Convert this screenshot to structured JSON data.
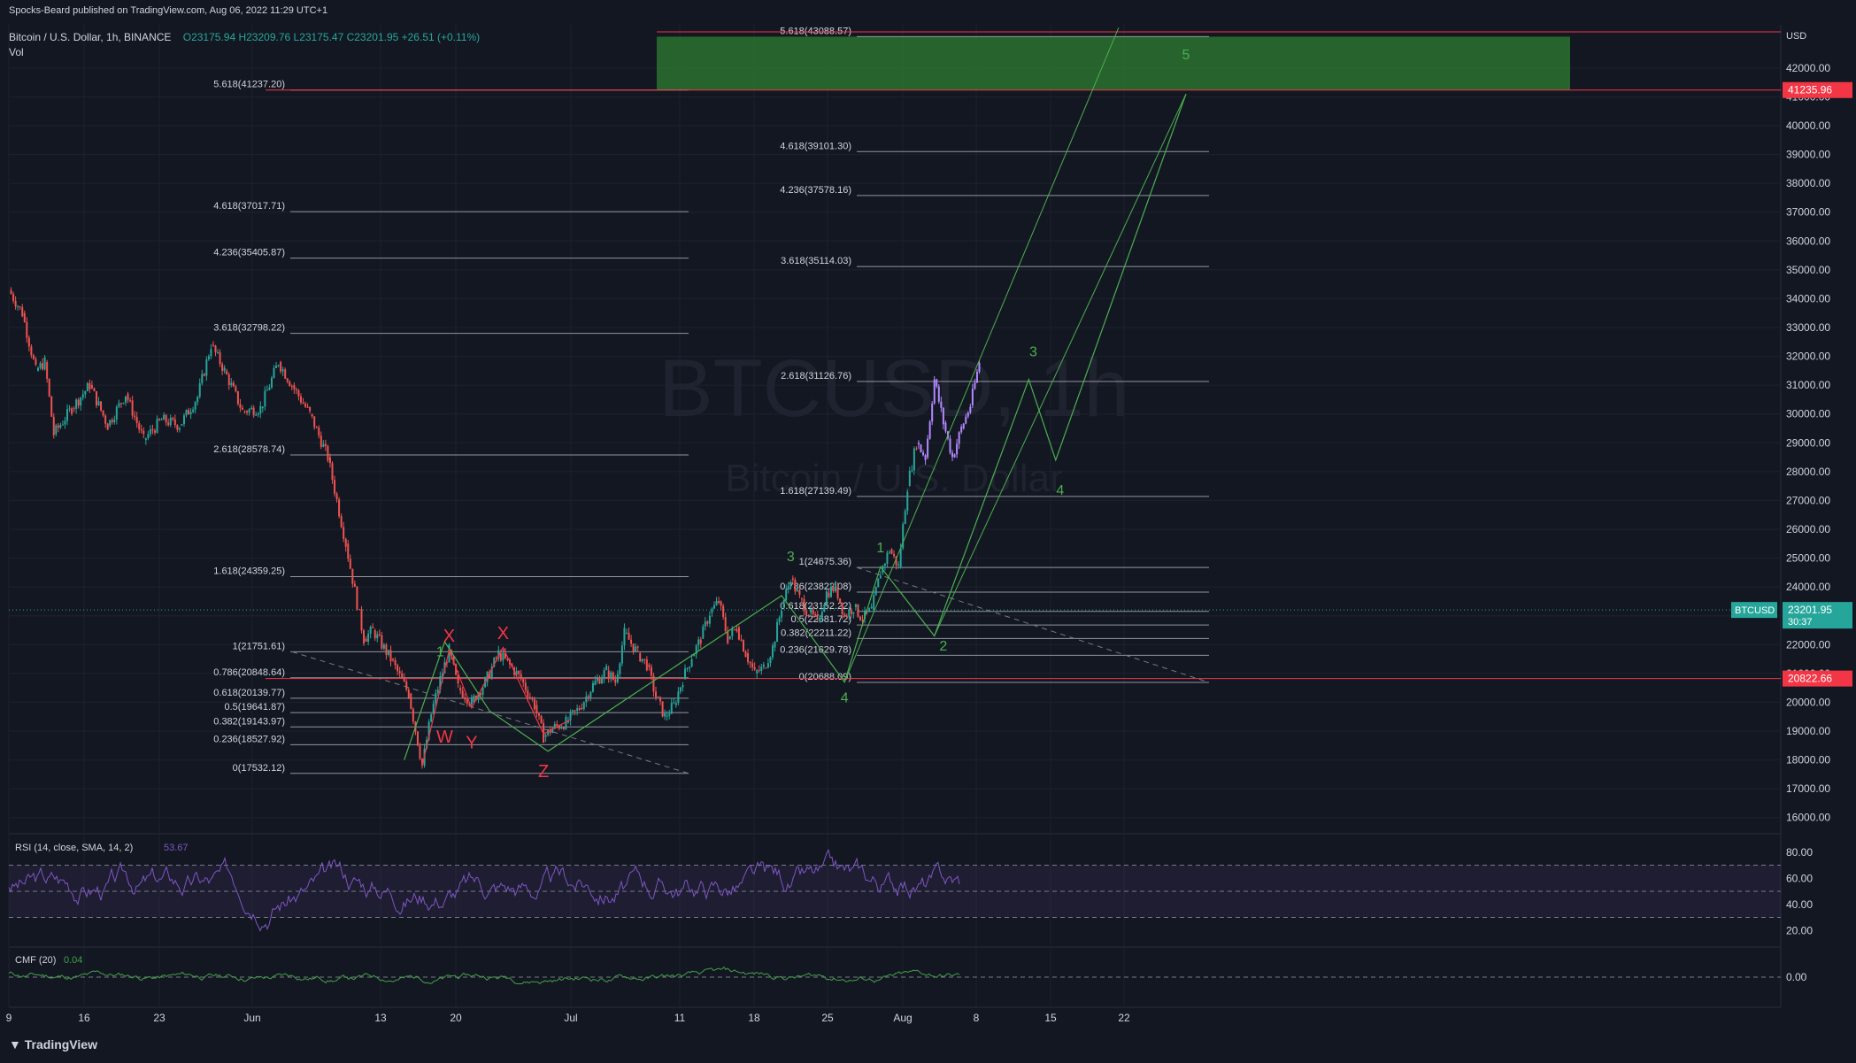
{
  "header": {
    "published": "Spocks-Beard published on TradingView.com, Aug 06, 2022 11:29 UTC+1",
    "symbol_line": "Bitcoin / U.S. Dollar, 1h, BINANCE",
    "ohlc": "O23175.94  H23209.76  L23175.47  C23201.95  +26.51 (+0.11%)",
    "vol_label": "Vol"
  },
  "watermark": {
    "symbol": "BTCUSD, 1h",
    "name": "Bitcoin / U.S. Dollar"
  },
  "footer": {
    "brand": "TradingView"
  },
  "colors": {
    "background": "#131722",
    "grid": "#1e222d",
    "up": "#26a69a",
    "down": "#ef5350",
    "wave": "#4caf50",
    "corrective": "#f23645",
    "rsi": "#7e57c2",
    "cmf": "#43a047",
    "fib": "#b2b5be",
    "price_tag": "#26a69a"
  },
  "chart_data": [
    {
      "type": "candlestick",
      "title": "Bitcoin / U.S. Dollar, 1h, BINANCE",
      "ylim": [
        15500,
        43500
      ],
      "price_axis": {
        "currency": "USD",
        "ticks": [
          16000,
          17000,
          18000,
          19000,
          20000,
          21000,
          22000,
          23000,
          24000,
          25000,
          26000,
          27000,
          28000,
          29000,
          30000,
          31000,
          32000,
          33000,
          34000,
          35000,
          36000,
          37000,
          38000,
          39000,
          40000,
          41000,
          42000
        ],
        "tick_labels": [
          "16000.00",
          "17000.00",
          "18000.00",
          "19000.00",
          "20000.00",
          "21000.00",
          "22000.00",
          "23000.00",
          "24000.00",
          "25000.00",
          "26000.00",
          "27000.00",
          "28000.00",
          "29000.00",
          "30000.00",
          "31000.00",
          "32000.00",
          "33000.00",
          "34000.00",
          "35000.00",
          "36000.00",
          "37000.00",
          "38000.00",
          "39000.00",
          "40000.00",
          "41000.00",
          "42000.00"
        ],
        "tags": [
          {
            "value": 41235.96,
            "label": "41235.96",
            "color": "#f23645"
          },
          {
            "value": 23201.95,
            "label": "23201.95",
            "sub": "30:37",
            "name": "BTCUSD",
            "color": "#26a69a"
          },
          {
            "value": 20822.66,
            "label": "20822.66",
            "color": "#f23645"
          }
        ]
      },
      "time_axis": {
        "labels": [
          "9",
          "16",
          "23",
          "Jun",
          "13",
          "20",
          "Jul",
          "11",
          "18",
          "25",
          "Aug",
          "8",
          "15",
          "22"
        ]
      },
      "price_path": [
        [
          0,
          34300
        ],
        [
          3,
          33500
        ],
        [
          6,
          31500
        ],
        [
          8,
          31800
        ],
        [
          10,
          29300
        ],
        [
          14,
          30200
        ],
        [
          18,
          31000
        ],
        [
          22,
          29600
        ],
        [
          26,
          30700
        ],
        [
          30,
          29100
        ],
        [
          34,
          29800
        ],
        [
          38,
          29600
        ],
        [
          42,
          30600
        ],
        [
          45,
          32400
        ],
        [
          48,
          31500
        ],
        [
          52,
          30100
        ],
        [
          56,
          30200
        ],
        [
          60,
          31800
        ],
        [
          63,
          31000
        ],
        [
          67,
          30000
        ],
        [
          71,
          28500
        ],
        [
          75,
          25500
        ],
        [
          79,
          22200
        ],
        [
          81,
          22500
        ],
        [
          85,
          21500
        ],
        [
          89,
          20300
        ],
        [
          92,
          17800
        ],
        [
          94,
          19600
        ],
        [
          96,
          20800
        ],
        [
          98,
          21800
        ],
        [
          100,
          20500
        ],
        [
          103,
          20000
        ],
        [
          106,
          20700
        ],
        [
          109,
          21700
        ],
        [
          112,
          21200
        ],
        [
          114,
          20800
        ],
        [
          117,
          19900
        ],
        [
          119,
          18800
        ],
        [
          121,
          19100
        ],
        [
          124,
          19300
        ],
        [
          127,
          19800
        ],
        [
          130,
          20600
        ],
        [
          133,
          21100
        ],
        [
          135,
          20700
        ],
        [
          137,
          22400
        ],
        [
          140,
          21700
        ],
        [
          142,
          21300
        ],
        [
          144,
          20200
        ],
        [
          146,
          19500
        ],
        [
          148,
          19900
        ],
        [
          150,
          20800
        ],
        [
          152,
          21600
        ],
        [
          154,
          22200
        ],
        [
          156,
          23100
        ],
        [
          158,
          23500
        ],
        [
          160,
          22200
        ],
        [
          162,
          22600
        ],
        [
          164,
          21700
        ],
        [
          166,
          21000
        ],
        [
          168,
          21200
        ],
        [
          170,
          21900
        ],
        [
          172,
          23300
        ],
        [
          174,
          24300
        ],
        [
          176,
          23600
        ],
        [
          178,
          23100
        ],
        [
          180,
          22800
        ],
        [
          182,
          23800
        ],
        [
          184,
          24000
        ],
        [
          186,
          23000
        ],
        [
          188,
          23300
        ],
        [
          190,
          22900
        ],
        [
          192,
          23200
        ],
        [
          194,
          24500
        ],
        [
          196,
          25300
        ],
        [
          198,
          24700
        ],
        [
          200,
          27500
        ],
        [
          202,
          29000
        ],
        [
          204,
          28500
        ],
        [
          206,
          31200
        ],
        [
          208,
          29700
        ],
        [
          210,
          28500
        ],
        [
          212,
          29500
        ],
        [
          214,
          30300
        ],
        [
          216,
          31800
        ]
      ],
      "projection_start_index": 202,
      "fib_levels_left": [
        {
          "label": "0(17532.12)",
          "value": 17532.12
        },
        {
          "label": "0.236(18527.92)",
          "value": 18527.92
        },
        {
          "label": "0.382(19143.97)",
          "value": 19143.97
        },
        {
          "label": "0.5(19641.87)",
          "value": 19641.87
        },
        {
          "label": "0.618(20139.77)",
          "value": 20139.77
        },
        {
          "label": "0.786(20848.64)",
          "value": 20848.64
        },
        {
          "label": "1(21751.61)",
          "value": 21751.61
        },
        {
          "label": "1.618(24359.25)",
          "value": 24359.25
        },
        {
          "label": "2.618(28578.74)",
          "value": 28578.74
        },
        {
          "label": "3.618(32798.22)",
          "value": 32798.22
        },
        {
          "label": "4.236(35405.87)",
          "value": 35405.87
        },
        {
          "label": "4.618(37017.71)",
          "value": 37017.71
        },
        {
          "label": "5.618(41237.20)",
          "value": 41237.2
        }
      ],
      "fib_levels_right": [
        {
          "label": "0(20688.09)",
          "value": 20688.09
        },
        {
          "label": "0.236(21629.78)",
          "value": 21629.78
        },
        {
          "label": "0.382(22211.22)",
          "value": 22211.22
        },
        {
          "label": "0.5(22681.72)",
          "value": 22681.72
        },
        {
          "label": "0.618(23152.22)",
          "value": 23152.22
        },
        {
          "label": "0.786(23822.08)",
          "value": 23822.08
        },
        {
          "label": "1(24675.36)",
          "value": 24675.36
        },
        {
          "label": "1.618(27139.49)",
          "value": 27139.49
        },
        {
          "label": "2.618(31126.76)",
          "value": 31126.76
        },
        {
          "label": "3.618(35114.03)",
          "value": 35114.03
        },
        {
          "label": "4.236(37578.16)",
          "value": 37578.16
        },
        {
          "label": "4.618(39101.30)",
          "value": 39101.3
        },
        {
          "label": "5.618(43088.57)",
          "value": 43088.57
        }
      ],
      "target_zone": {
        "from": 41235.96,
        "to": 43088.57
      },
      "wave_labels": [
        {
          "text": "X",
          "t": 98,
          "price": 22100,
          "color": "corrective"
        },
        {
          "text": "X",
          "t": 110,
          "price": 22200,
          "color": "corrective"
        },
        {
          "text": "W",
          "t": 97,
          "price": 18600,
          "color": "corrective"
        },
        {
          "text": "Y",
          "t": 103,
          "price": 18400,
          "color": "corrective"
        },
        {
          "text": "Z",
          "t": 119,
          "price": 17400,
          "color": "corrective"
        },
        {
          "text": "1",
          "t": 96,
          "price": 21600,
          "color": "wave"
        },
        {
          "text": "3",
          "t": 174,
          "price": 24900,
          "color": "wave"
        },
        {
          "text": "4",
          "t": 186,
          "price": 20000,
          "color": "wave"
        },
        {
          "text": "1",
          "t": 194,
          "price": 25200,
          "color": "wave"
        },
        {
          "text": "2",
          "t": 208,
          "price": 21800,
          "color": "wave"
        },
        {
          "text": "3",
          "t": 228,
          "price": 32000,
          "color": "wave"
        },
        {
          "text": "4",
          "t": 234,
          "price": 27200,
          "color": "wave"
        },
        {
          "text": "5",
          "t": 262,
          "price": 42300,
          "color": "wave"
        }
      ]
    },
    {
      "type": "line",
      "title": "RSI (14, close, SMA, 14, 2)",
      "last_value": "53.67",
      "ylim": [
        10,
        90
      ],
      "tick_labels": [
        "80.00",
        "60.00",
        "40.00",
        "20.00"
      ],
      "ticks": [
        80,
        60,
        40,
        20
      ],
      "bands": [
        30,
        50,
        70
      ]
    },
    {
      "type": "line",
      "title": "CMF (20)",
      "last_value": "0.04",
      "ylim": [
        -0.4,
        0.4
      ],
      "ticks": [
        0
      ],
      "tick_labels": [
        "0.00"
      ]
    }
  ]
}
